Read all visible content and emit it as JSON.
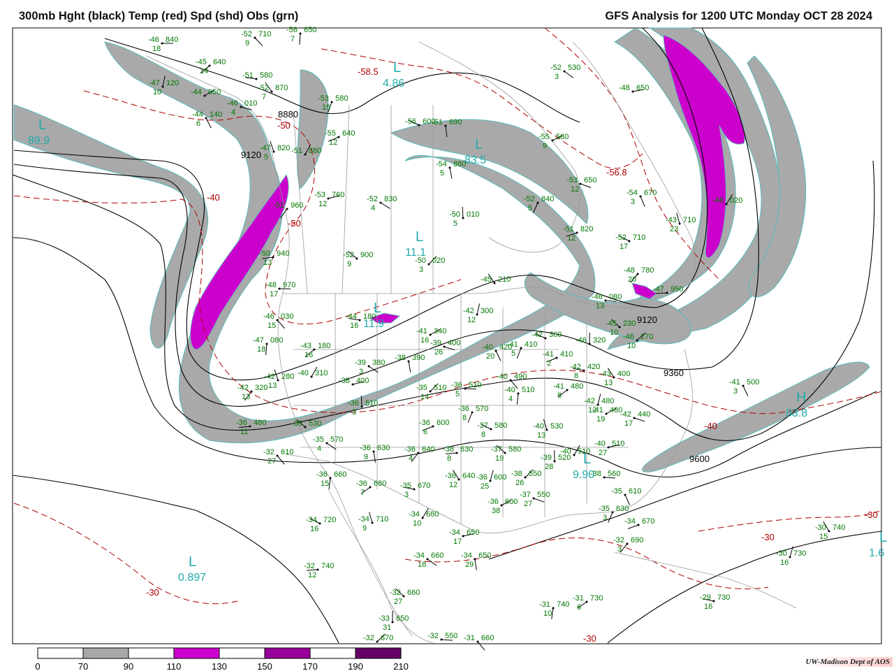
{
  "header": {
    "title_left": "300mb Hght (black) Temp (red) Spd (shd) Obs (grn)",
    "title_right": "GFS Analysis for 1200 UTC Monday  OCT 28 2024"
  },
  "credit": "UW-Madison  Dept of AOS",
  "colors": {
    "height_contour": "#000000",
    "temperature_contour": "#b00000",
    "speed_70_90": "#a9a9a9",
    "speed_110_130": "#cc00cc",
    "speed_150_170": "#990099",
    "speed_190_210": "#660066",
    "observations": "#007700",
    "centers": "#22aaaa",
    "borders": "#999999"
  },
  "legend": {
    "ticks": [
      "0",
      "70",
      "90",
      "110",
      "130",
      "150",
      "170",
      "190",
      "210"
    ],
    "fill_colors": [
      "#ffffff",
      "#a9a9a9",
      "#ffffff",
      "#cc00cc",
      "#ffffff",
      "#990099",
      "#ffffff",
      "#660066"
    ]
  },
  "height_labels": [
    "8880",
    "9120",
    "9120",
    "9360",
    "9600"
  ],
  "temperature_labels": [
    "-58.5",
    "-56.8",
    "-50",
    "-50",
    "-40",
    "-40",
    "-30",
    "-30",
    "-30",
    "-30"
  ],
  "centers": [
    {
      "type": "L",
      "value": "89.9"
    },
    {
      "type": "L",
      "value": "4.86"
    },
    {
      "type": "L",
      "value": "83.5"
    },
    {
      "type": "L",
      "value": "11.1"
    },
    {
      "type": "L",
      "value": "0.897"
    },
    {
      "type": "L",
      "value": "9.90"
    },
    {
      "type": "H",
      "value": "83.8"
    },
    {
      "type": "L",
      "value": "1.6"
    },
    {
      "type": "L",
      "value": "11.9"
    }
  ],
  "observations": [
    {
      "t": "-46",
      "h": "840",
      "s": "18"
    },
    {
      "t": "-52",
      "h": "710",
      "s": "9"
    },
    {
      "t": "-56",
      "h": "650",
      "s": "7"
    },
    {
      "t": "-45",
      "h": "640",
      "s": "14"
    },
    {
      "t": "-51",
      "h": "580",
      "s": ""
    },
    {
      "t": "-52",
      "h": "870",
      "s": "7"
    },
    {
      "t": "-47",
      "h": "120",
      "s": "10"
    },
    {
      "t": "-44",
      "h": "050",
      "s": ""
    },
    {
      "t": "-46",
      "h": "010",
      "s": "4"
    },
    {
      "t": "-44",
      "h": "140",
      "s": "6"
    },
    {
      "t": "-53",
      "h": "580",
      "s": "15"
    },
    {
      "t": "-55",
      "h": "640",
      "s": "12"
    },
    {
      "t": "-56",
      "h": "600",
      "s": ""
    },
    {
      "t": "-47",
      "h": "820",
      "s": "5"
    },
    {
      "t": "-51",
      "h": "880",
      "s": ""
    },
    {
      "t": "-53",
      "h": "760",
      "s": "12"
    },
    {
      "t": "-52",
      "h": "830",
      "s": "4"
    },
    {
      "t": "-54",
      "h": "880",
      "s": "5"
    },
    {
      "t": "-51",
      "h": "960",
      "s": ""
    },
    {
      "t": "-50",
      "h": "940",
      "s": "13"
    },
    {
      "t": "-52",
      "h": "900",
      "s": "9"
    },
    {
      "t": "-50",
      "h": "010",
      "s": "5"
    },
    {
      "t": "-50",
      "h": "020",
      "s": "3"
    },
    {
      "t": "-48",
      "h": "970",
      "s": "17"
    },
    {
      "t": "-46",
      "h": "030",
      "s": "15"
    },
    {
      "t": "-47",
      "h": "080",
      "s": "18"
    },
    {
      "t": "-43",
      "h": "180",
      "s": "16"
    },
    {
      "t": "-44",
      "h": "180",
      "s": "16"
    },
    {
      "t": "-45",
      "h": "210",
      "s": ""
    },
    {
      "t": "-42",
      "h": "300",
      "s": "12"
    },
    {
      "t": "-41",
      "h": "340",
      "s": "16"
    },
    {
      "t": "-39",
      "h": "400",
      "s": "26"
    },
    {
      "t": "-40",
      "h": "420",
      "s": "20"
    },
    {
      "t": "-41",
      "h": "410",
      "s": "5"
    },
    {
      "t": "-41",
      "h": "410",
      "s": "2"
    },
    {
      "t": "-42",
      "h": "360",
      "s": ""
    },
    {
      "t": "-42",
      "h": "280",
      "s": "13"
    },
    {
      "t": "-40",
      "h": "310",
      "s": ""
    },
    {
      "t": "-38",
      "h": "400",
      "s": ""
    },
    {
      "t": "-39",
      "h": "380",
      "s": "3"
    },
    {
      "t": "-38",
      "h": "390",
      "s": ""
    },
    {
      "t": "-42",
      "h": "320",
      "s": "13"
    },
    {
      "t": "-36",
      "h": "480",
      "s": "11"
    },
    {
      "t": "-36",
      "h": "530",
      "s": ""
    },
    {
      "t": "-36",
      "h": "510",
      "s": "3"
    },
    {
      "t": "-35",
      "h": "510",
      "s": "14"
    },
    {
      "t": "-36",
      "h": "510",
      "s": "5"
    },
    {
      "t": "-40",
      "h": "490",
      "s": ""
    },
    {
      "t": "-40",
      "h": "510",
      "s": "4"
    },
    {
      "t": "-41",
      "h": "480",
      "s": "8"
    },
    {
      "t": "-42",
      "h": "420",
      "s": "8"
    },
    {
      "t": "-43",
      "h": "400",
      "s": "13"
    },
    {
      "t": "-42",
      "h": "480",
      "s": "12"
    },
    {
      "t": "-41",
      "h": "480",
      "s": "19"
    },
    {
      "t": "-42",
      "h": "440",
      "s": "17"
    },
    {
      "t": "-41",
      "h": "500",
      "s": "3"
    },
    {
      "t": "-36",
      "h": "570",
      "s": "8"
    },
    {
      "t": "-36",
      "h": "600",
      "s": "6"
    },
    {
      "t": "-37",
      "h": "580",
      "s": "8"
    },
    {
      "t": "-40",
      "h": "530",
      "s": "13"
    },
    {
      "t": "-40",
      "h": "510",
      "s": ""
    },
    {
      "t": "-40",
      "h": "510",
      "s": "27"
    },
    {
      "t": "-35",
      "h": "570",
      "s": "4"
    },
    {
      "t": "-36",
      "h": "630",
      "s": "9"
    },
    {
      "t": "-36",
      "h": "640",
      "s": "4"
    },
    {
      "t": "-38",
      "h": "630",
      "s": "8"
    },
    {
      "t": "-37",
      "h": "580",
      "s": "19"
    },
    {
      "t": "-39",
      "h": "520",
      "s": "28"
    },
    {
      "t": "-38",
      "h": "550",
      "s": "26"
    },
    {
      "t": "-38",
      "h": "560",
      "s": ""
    },
    {
      "t": "-32",
      "h": "610",
      "s": "27"
    },
    {
      "t": "-36",
      "h": "660",
      "s": "15"
    },
    {
      "t": "-36",
      "h": "680",
      "s": "7"
    },
    {
      "t": "-35",
      "h": "670",
      "s": "3"
    },
    {
      "t": "-36",
      "h": "640",
      "s": "12"
    },
    {
      "t": "-36",
      "h": "600",
      "s": "25"
    },
    {
      "t": "-36",
      "h": "600",
      "s": "38"
    },
    {
      "t": "-37",
      "h": "550",
      "s": "27"
    },
    {
      "t": "-35",
      "h": "610",
      "s": ""
    },
    {
      "t": "-35",
      "h": "630",
      "s": "3"
    },
    {
      "t": "-34",
      "h": "670",
      "s": ""
    },
    {
      "t": "-34",
      "h": "720",
      "s": "16"
    },
    {
      "t": "-34",
      "h": "710",
      "s": "9"
    },
    {
      "t": "-34",
      "h": "680",
      "s": "10"
    },
    {
      "t": "-34",
      "h": "650",
      "s": "17"
    },
    {
      "t": "-34",
      "h": "660",
      "s": "18"
    },
    {
      "t": "-34",
      "h": "650",
      "s": "29"
    },
    {
      "t": "-32",
      "h": "690",
      "s": "3"
    },
    {
      "t": "-32",
      "h": "740",
      "s": "12"
    },
    {
      "t": "-32",
      "h": "660",
      "s": "27"
    },
    {
      "t": "-33",
      "h": "650",
      "s": "31"
    },
    {
      "t": "-32",
      "h": "670",
      "s": ""
    },
    {
      "t": "-32",
      "h": "550",
      "s": ""
    },
    {
      "t": "-31",
      "h": "660",
      "s": ""
    },
    {
      "t": "-31",
      "h": "740",
      "s": "10"
    },
    {
      "t": "-31",
      "h": "730",
      "s": "6"
    },
    {
      "t": "-29",
      "h": "730",
      "s": "16"
    },
    {
      "t": "-30",
      "h": "740",
      "s": "15"
    },
    {
      "t": "-30",
      "h": "730",
      "s": "16"
    },
    {
      "t": "-55",
      "h": "580",
      "s": "9"
    },
    {
      "t": "-53",
      "h": "650",
      "s": "12"
    },
    {
      "t": "-54",
      "h": "670",
      "s": "3"
    },
    {
      "t": "-52",
      "h": "840",
      "s": "5"
    },
    {
      "t": "-51",
      "h": "820",
      "s": "12"
    },
    {
      "t": "-52",
      "h": "710",
      "s": "17"
    },
    {
      "t": "-43",
      "h": "710",
      "s": "23"
    },
    {
      "t": "-48",
      "h": "020",
      "s": ""
    },
    {
      "t": "-48",
      "h": "650",
      "s": ""
    },
    {
      "t": "-52",
      "h": "530",
      "s": "3"
    },
    {
      "t": "-51",
      "h": "690",
      "s": ""
    },
    {
      "t": "-48",
      "h": "780",
      "s": "20"
    },
    {
      "t": "-47",
      "h": "950",
      "s": ""
    },
    {
      "t": "-45",
      "h": "230",
      "s": "10"
    },
    {
      "t": "-46",
      "h": "320",
      "s": ""
    },
    {
      "t": "-46",
      "h": "270",
      "s": "10"
    },
    {
      "t": "-46",
      "h": "080",
      "s": "13"
    }
  ]
}
